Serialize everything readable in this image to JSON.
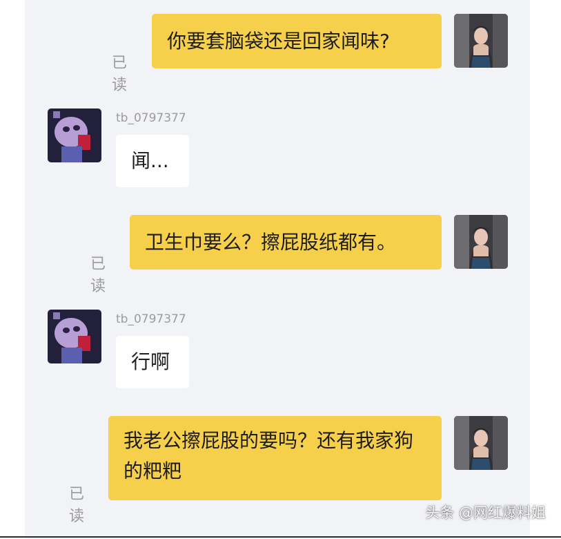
{
  "messages": [
    {
      "side": "out",
      "text": "你要套脑袋还是回家闻味?",
      "status": "已读"
    },
    {
      "side": "in",
      "sender": "tb_0797377",
      "text": "闻..."
    },
    {
      "side": "out",
      "text": "卫生巾要么？擦屁股纸都有。",
      "status": "已读"
    },
    {
      "side": "in",
      "sender": "tb_0797377",
      "text": "行啊"
    },
    {
      "side": "out",
      "text": "我老公擦屁股的要吗？还有我家狗的粑粑",
      "status": "已读"
    }
  ],
  "watermark": "头条 @网红爆料姐",
  "colors": {
    "outgoing_bubble": "#f6cf4b",
    "incoming_bubble": "#ffffff",
    "chat_background": "#f2f3f7"
  }
}
